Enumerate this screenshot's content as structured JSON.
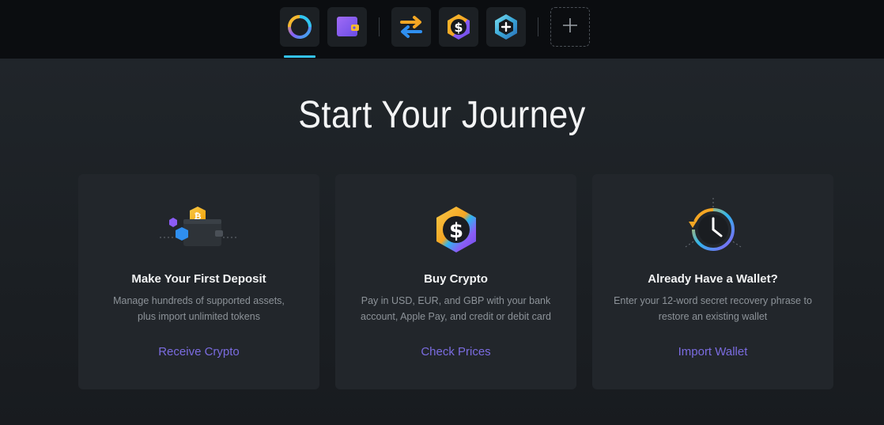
{
  "topbar": {
    "tabs": [
      {
        "name": "portfolio",
        "icon": "portfolio-ring-icon",
        "active": true
      },
      {
        "name": "wallet",
        "icon": "wallet-icon",
        "active": false
      },
      {
        "name": "exchange",
        "icon": "exchange-arrows-icon",
        "active": false
      },
      {
        "name": "buy-crypto",
        "icon": "dollar-hexagon-icon",
        "active": false
      },
      {
        "name": "add-asset",
        "icon": "plus-hexagon-icon",
        "active": false
      }
    ],
    "add_button_icon": "plus-icon",
    "accent_color": "#34c3f0"
  },
  "main": {
    "heading": "Start Your Journey",
    "cards": [
      {
        "icon": "wallet-deposit-icon",
        "title": "Make Your First Deposit",
        "desc_line1": "Manage hundreds of supported assets,",
        "desc_line2": "plus import unlimited tokens",
        "action": "Receive Crypto"
      },
      {
        "icon": "dollar-hexagon-icon",
        "title": "Buy Crypto",
        "desc_line1": "Pay in USD, EUR, and GBP with your bank",
        "desc_line2": "account, Apple Pay, and credit or debit card",
        "action": "Check Prices"
      },
      {
        "icon": "clock-restore-icon",
        "title": "Already Have a Wallet?",
        "desc_line1": "Enter your 12-word secret recovery phrase to",
        "desc_line2": "restore an existing wallet",
        "action": "Import Wallet"
      }
    ],
    "link_color": "#7b6ce0"
  }
}
